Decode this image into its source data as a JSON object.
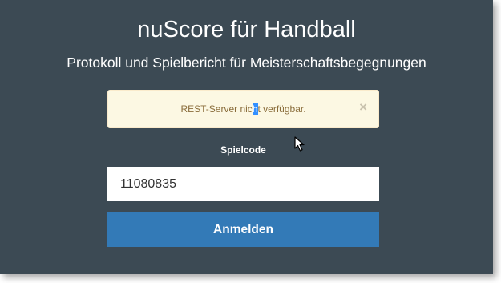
{
  "header": {
    "title": "nuScore für Handball",
    "subtitle": "Protokoll und Spielbericht für Meisterschaftsbegegnungen"
  },
  "alert": {
    "message_before": "REST-Server nic",
    "message_selected": "h",
    "message_after": "t verfügbar.",
    "close_label": "×"
  },
  "login": {
    "field_label": "Spielcode",
    "code_value": "11080835",
    "button_label": "Anmelden"
  },
  "icons": {
    "pointer": "mouse-pointer-icon"
  },
  "colors": {
    "background": "#3c4a54",
    "alert_background": "#fcf8e3",
    "alert_text": "#8a6d3b",
    "button": "#337ab7"
  }
}
